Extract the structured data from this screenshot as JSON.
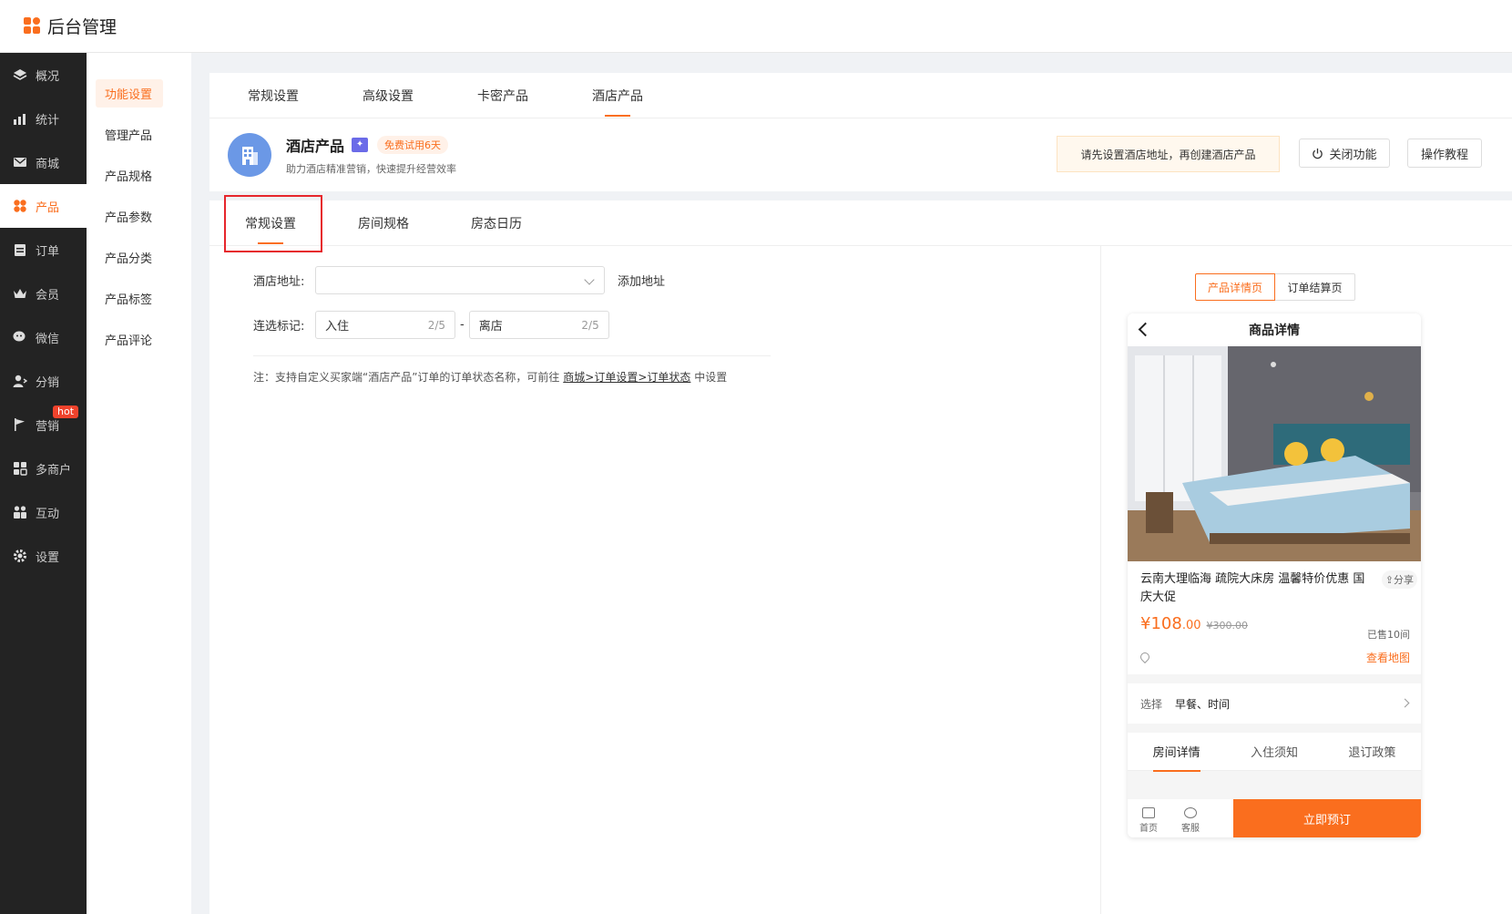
{
  "app": {
    "title": "后台管理"
  },
  "sidebar": {
    "items": [
      {
        "label": "概况",
        "icon": "layers-icon"
      },
      {
        "label": "统计",
        "icon": "chart-icon"
      },
      {
        "label": "商城",
        "icon": "mail-icon"
      },
      {
        "label": "产品",
        "icon": "product-icon",
        "active": true
      },
      {
        "label": "订单",
        "icon": "order-icon"
      },
      {
        "label": "会员",
        "icon": "crown-icon"
      },
      {
        "label": "微信",
        "icon": "wechat-icon"
      },
      {
        "label": "分销",
        "icon": "user-share-icon"
      },
      {
        "label": "营销",
        "icon": "flag-icon",
        "badge": "hot"
      },
      {
        "label": "多商户",
        "icon": "store-icon"
      },
      {
        "label": "互动",
        "icon": "interact-icon"
      },
      {
        "label": "设置",
        "icon": "gear-icon"
      }
    ]
  },
  "subnav": {
    "items": [
      "功能设置",
      "管理产品",
      "产品规格",
      "产品参数",
      "产品分类",
      "产品标签",
      "产品评论"
    ]
  },
  "top_tabs": [
    "常规设置",
    "高级设置",
    "卡密产品",
    "酒店产品"
  ],
  "product": {
    "name": "酒店产品",
    "trial": "免费试用6天",
    "desc": "助力酒店精准营销，快速提升经营效率",
    "notice": "请先设置酒店地址，再创建酒店产品",
    "close_btn": "关闭功能",
    "tutorial_btn": "操作教程"
  },
  "sub_tabs": [
    "常规设置",
    "房间规格",
    "房态日历"
  ],
  "form": {
    "address_label": "酒店地址:",
    "add_address": "添加地址",
    "mark_label": "连选标记:",
    "checkin_value": "入住",
    "checkin_count": "2/5",
    "dash": "-",
    "checkout_value": "离店",
    "checkout_count": "2/5",
    "note_prefix": "注：支持自定义买家端“酒店产品”订单的订单状态名称，可前往",
    "note_link": "商城>订单设置>订单状态",
    "note_suffix": "中设置"
  },
  "preview": {
    "switch_detail": "产品详情页",
    "switch_checkout": "订单结算页",
    "header": "商品详情",
    "title": "云南大理临海 疏院大床房 温馨特价优惠 国庆大促",
    "share": "分享",
    "price_int": "¥108",
    "price_dec": ".00",
    "old_price": "¥300.00",
    "sold": "已售10间",
    "map": "查看地图",
    "select_label": "选择",
    "select_value": "早餐、时间",
    "tabs": [
      "房间详情",
      "入住须知",
      "退订政策"
    ],
    "nav_home": "首页",
    "nav_service": "客服",
    "book": "立即预订"
  },
  "colors": {
    "accent": "#fa6e1e",
    "sidebar_bg": "#232323",
    "highlight": "#e6262c"
  }
}
